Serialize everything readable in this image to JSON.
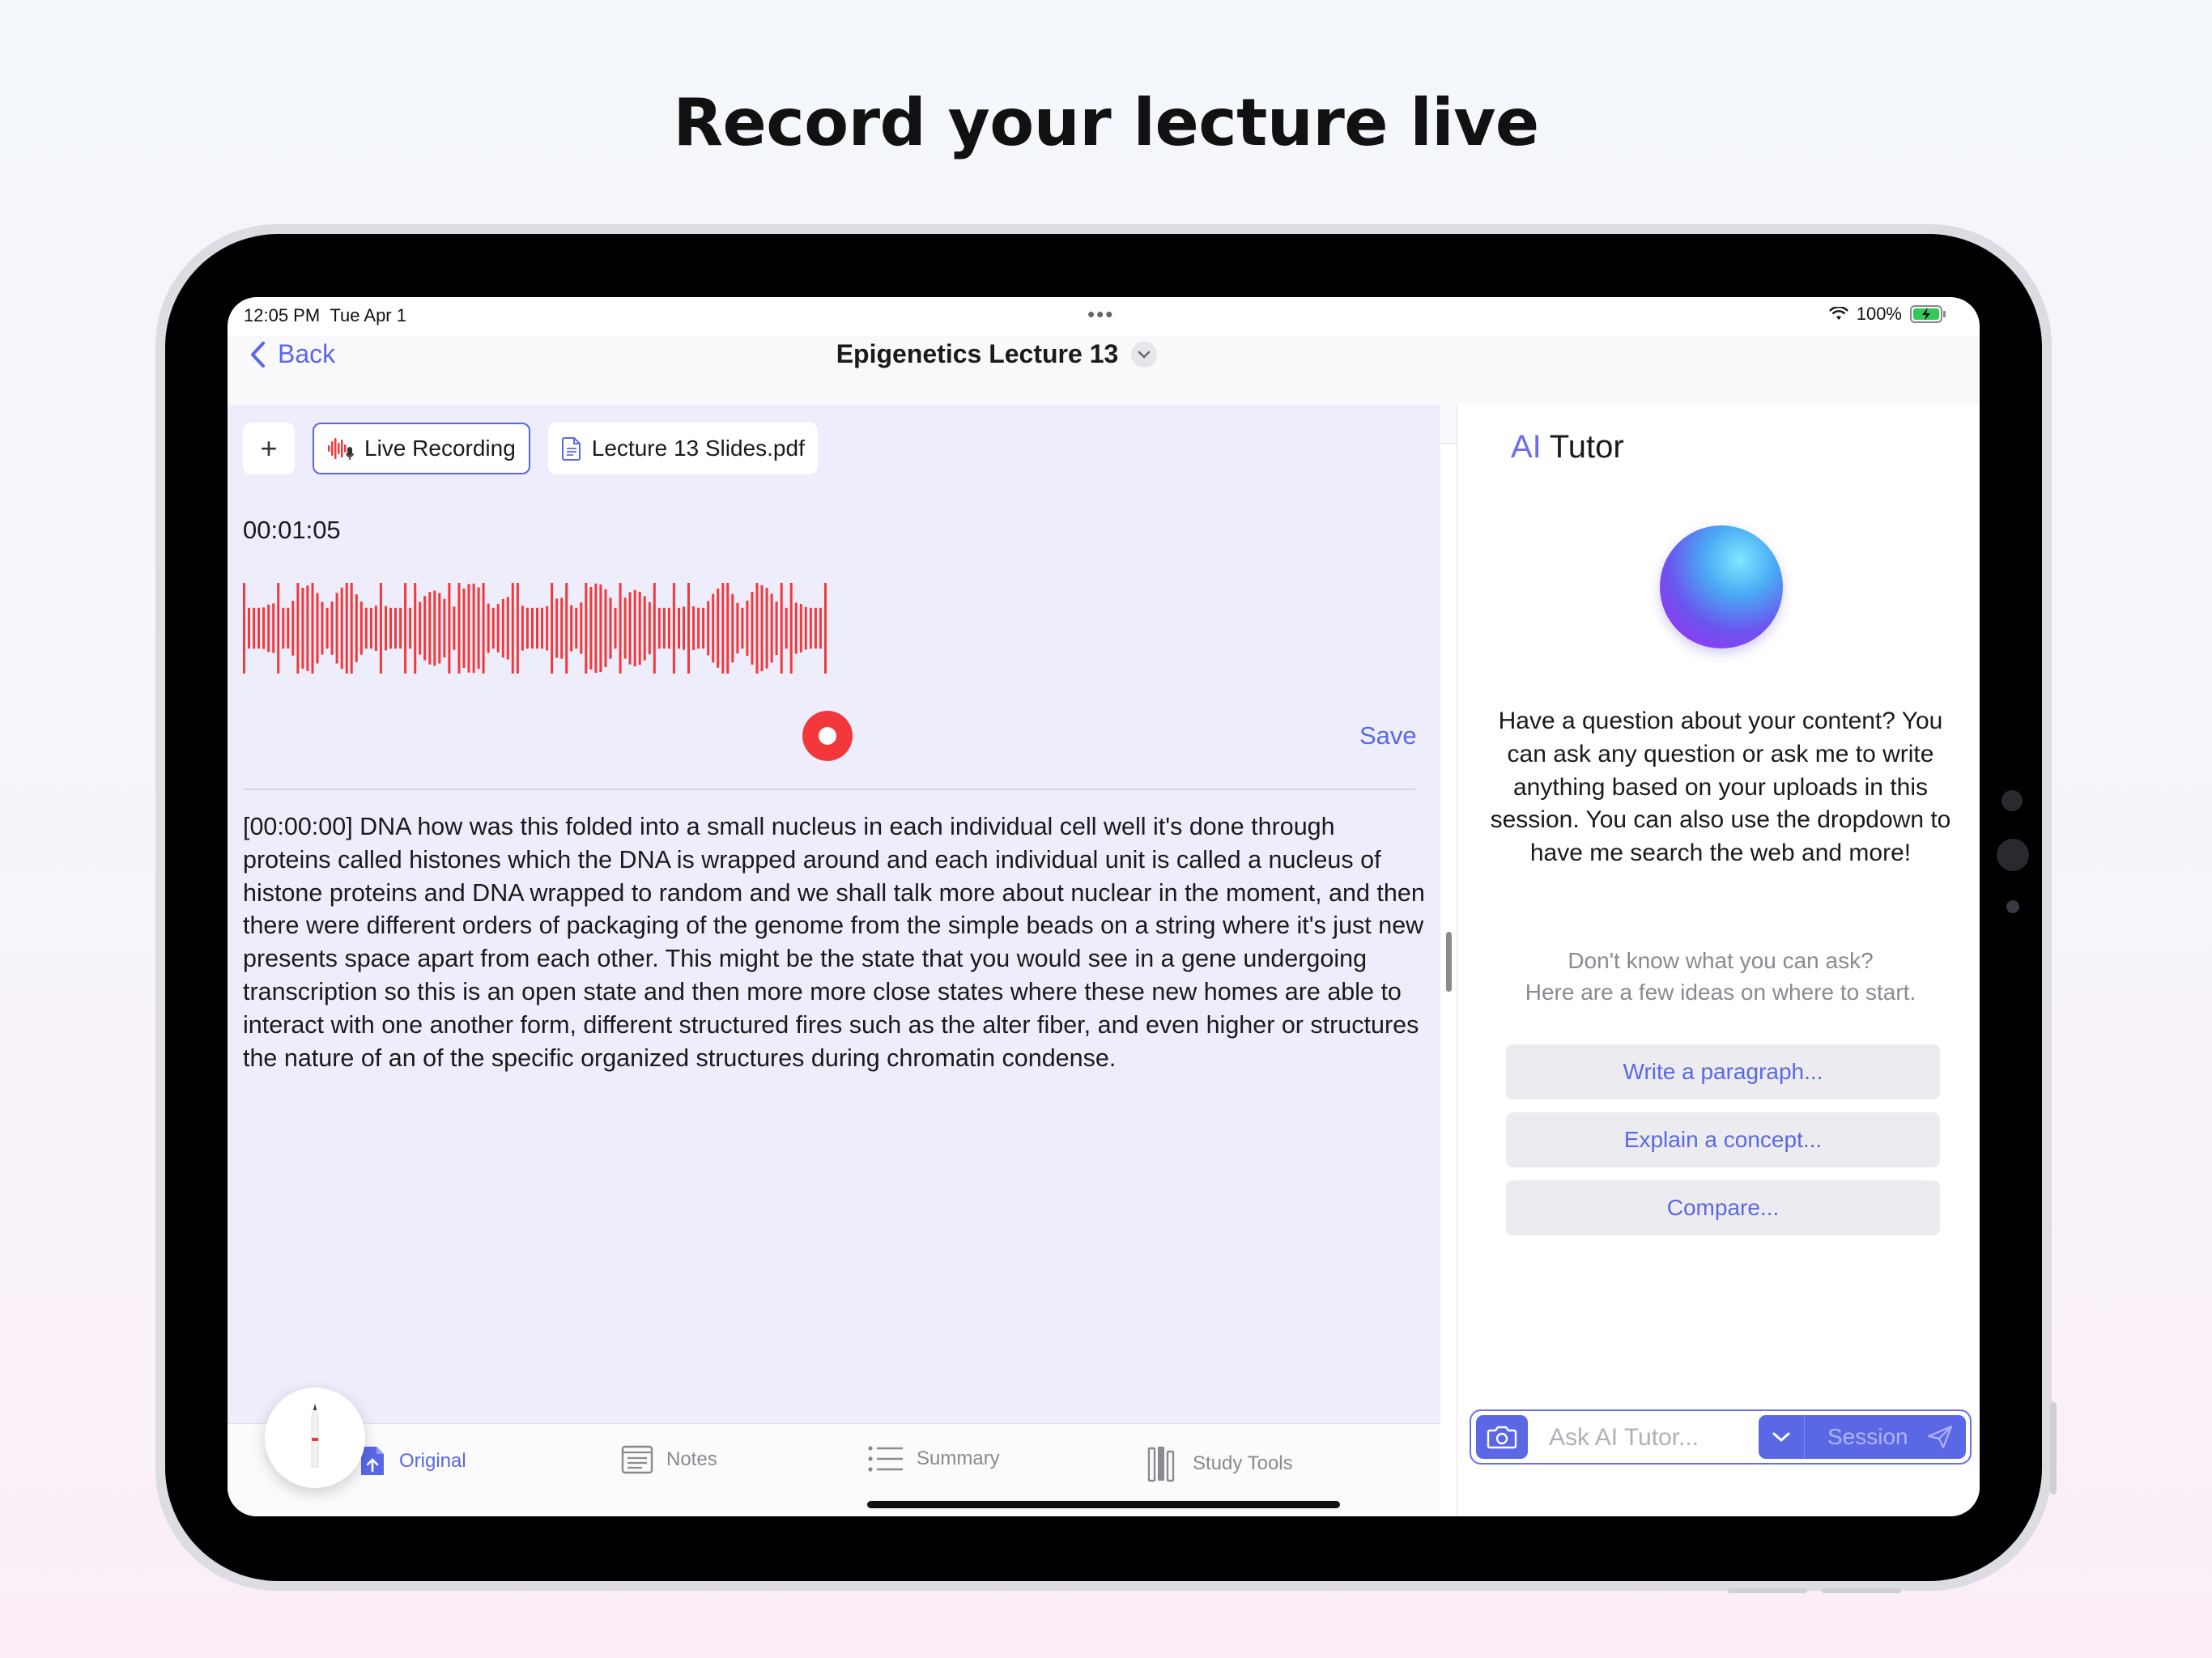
{
  "marketing": {
    "headline": "Record your lecture live"
  },
  "status_bar": {
    "time": "12:05 PM",
    "date": "Tue Apr 1",
    "battery": "100%"
  },
  "nav": {
    "back_label": "Back",
    "title": "Epigenetics Lecture 13"
  },
  "sources": {
    "add_label": "+",
    "tabs": [
      {
        "label": "Live Recording",
        "icon": "waveform-mic-icon",
        "active": true
      },
      {
        "label": "Lecture 13 Slides.pdf",
        "icon": "document-icon",
        "active": false
      }
    ]
  },
  "recorder": {
    "elapsed": "00:01:05",
    "save_label": "Save",
    "waveform_color": "#f2383a",
    "state": "recording"
  },
  "transcript": {
    "text": "[00:00:00] DNA how was this folded into a small nucleus in each individual cell well it's done through proteins called histones which the DNA is wrapped around and each individual unit is called a nucleus of histone proteins and DNA wrapped to random and we shall talk more about nuclear in the moment, and then there were different orders of packaging of the genome from the simple beads on a string where it's just new presents space apart from each other. This might be the state that you would see in a gene undergoing transcription so this is an open state and then more more close states where these new homes are able to interact with one another form, different structured fires such as the alter fiber, and even higher or structures the nature of an of the specific organized structures during chromatin condense."
  },
  "bottom_tabs": [
    {
      "label": "Original",
      "icon": "upload-document-icon",
      "active": true
    },
    {
      "label": "Notes",
      "icon": "notes-icon",
      "active": false
    },
    {
      "label": "Summary",
      "icon": "list-icon",
      "active": false
    },
    {
      "label": "Study Tools",
      "icon": "books-icon",
      "active": false
    }
  ],
  "ai_tutor": {
    "title_prefix": "AI",
    "title": "Tutor",
    "description": "Have a question about your content? You can ask any question or ask me to write anything based on your uploads in this session. You can also use the dropdown to have me search the web and more!",
    "hint_line1": "Don't know what you can ask?",
    "hint_line2": "Here are a few ideas on where to start.",
    "suggestions": [
      "Write a paragraph...",
      "Explain a concept...",
      "Compare..."
    ],
    "input_placeholder": "Ask AI Tutor...",
    "scope_label": "Session"
  },
  "colors": {
    "accent": "#5a68e6",
    "record": "#f2383a",
    "panel_bg": "#eeedfb"
  }
}
